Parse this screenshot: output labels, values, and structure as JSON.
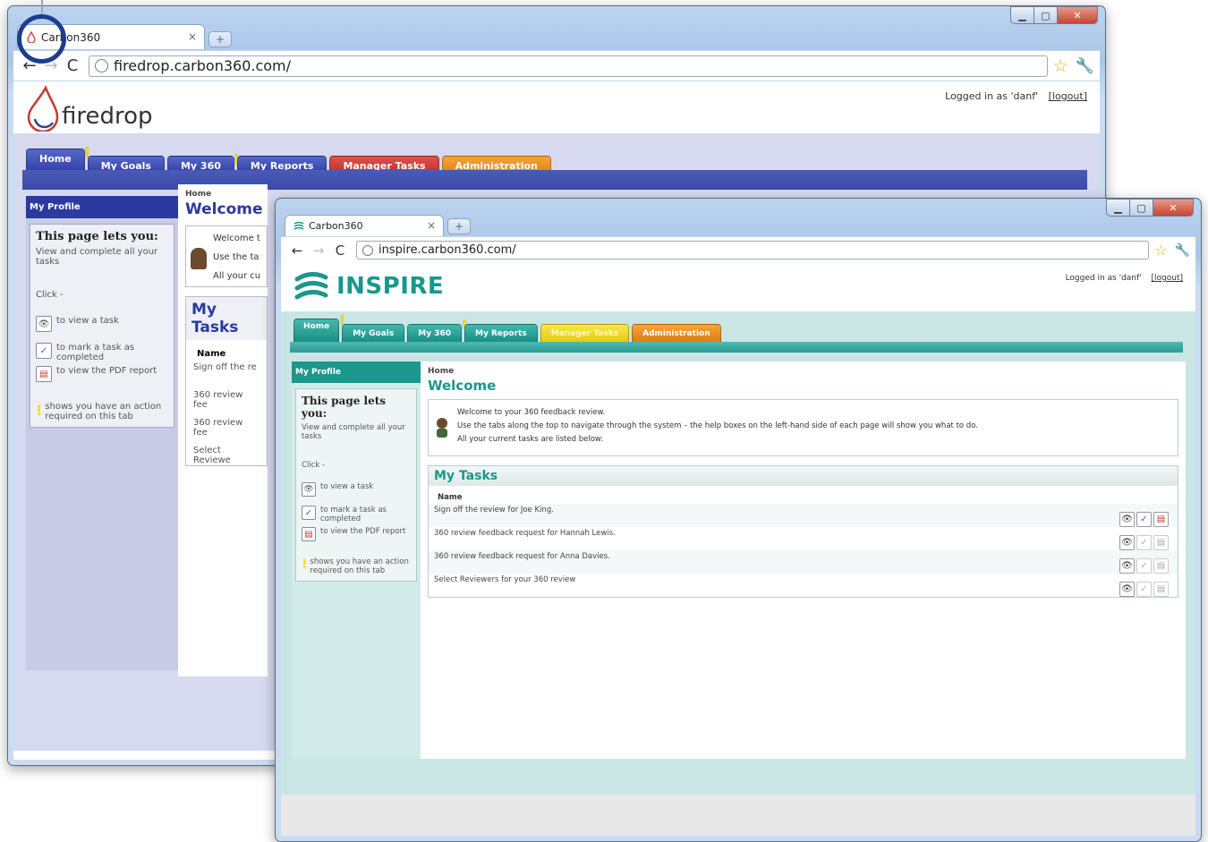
{
  "windows": {
    "firedrop": {
      "tab_title": "Carbon360",
      "url": "firedrop.carbon360.com/",
      "logo_text": "firedrop",
      "login_text": "Logged in as 'danf'",
      "logout_label": "[logout]",
      "nav_tabs": [
        "Home",
        "My Goals",
        "My 360",
        "My Reports",
        "Manager Tasks",
        "Administration"
      ],
      "panel_title": "My Profile",
      "help": {
        "heading": "This page lets you:",
        "intro": "View and complete all your tasks",
        "click": "Click -",
        "view": "to view a task",
        "mark": "to mark a task as completed",
        "pdf": "to view the PDF report",
        "action": "shows you have an action required on this tab"
      },
      "crumb": "Home",
      "welcome": "Welcome",
      "welcome_lines": [
        "Welcome t",
        "Use the ta",
        "All your cu"
      ],
      "tasks_title": "My Tasks",
      "name_col": "Name",
      "tasks": [
        "Sign off the re",
        "360 review fee",
        "360 review fee",
        "Select Reviewe"
      ]
    },
    "inspire": {
      "tab_title": "Carbon360",
      "url": "inspire.carbon360.com/",
      "logo_text": "INSPIRE",
      "login_text": "Logged in as 'danf'",
      "logout_label": "[logout]",
      "nav_tabs": [
        "Home",
        "My Goals",
        "My 360",
        "My Reports",
        "Manager Tasks",
        "Administration"
      ],
      "panel_title": "My Profile",
      "help": {
        "heading": "This page lets you:",
        "intro": "View and complete all your tasks",
        "click": "Click -",
        "view": "to view a task",
        "mark": "to mark a task as completed",
        "pdf": "to view the PDF report",
        "action": "shows you have an action required on this tab"
      },
      "crumb": "Home",
      "welcome": "Welcome",
      "welcome_lines": [
        "Welcome to your 360 feedback review.",
        "Use the tabs along the top to navigate through the system – the help boxes on the left-hand side of each page will show you what to do.",
        "All your current tasks are listed below:"
      ],
      "tasks_title": "My Tasks",
      "name_col": "Name",
      "tasks": [
        "Sign off the review for Joe King.",
        "360 review feedback request for Hannah Lewis.",
        "360 review feedback request for Anna Davies.",
        "Select Reviewers for your 360 review"
      ]
    }
  },
  "colors": {
    "firedrop_blue": "#2b3aa0",
    "inspire_teal": "#1c978c",
    "alert_yellow": "#f6e000"
  }
}
